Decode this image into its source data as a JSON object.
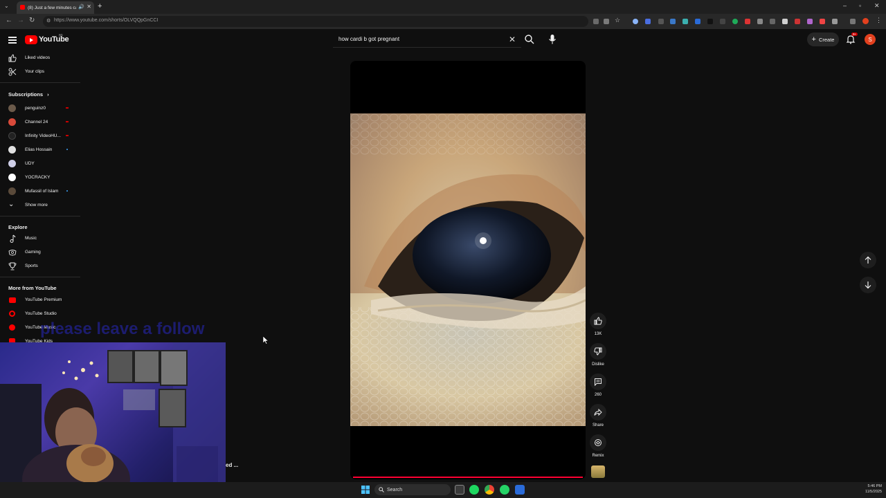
{
  "browser": {
    "tab_title": "(8) Just a few minutes can !",
    "url": "https://www.youtube.com/shorts/OLVQQpGnCCI"
  },
  "header": {
    "logo_text": "YouTube",
    "logo_sup": "80",
    "search_value": "how cardi b got pregnant",
    "create_label": "Create",
    "notif_count": "9+",
    "avatar_letter": "S"
  },
  "sidebar": {
    "top_items": [
      {
        "label": "Liked videos",
        "icon": "thumbs-up-icon"
      },
      {
        "label": "Your clips",
        "icon": "scissors-icon"
      }
    ],
    "subscriptions_heading": "Subscriptions",
    "subscriptions": [
      {
        "label": "penguinz0",
        "status": "live",
        "color": "#6b5a4a"
      },
      {
        "label": "Channel 24",
        "status": "live",
        "color": "#d84a3a"
      },
      {
        "label": "Infinity VideoHU...",
        "status": "live",
        "color": "#222222"
      },
      {
        "label": "Elias Hossain",
        "status": "new",
        "color": "#e0e0e0"
      },
      {
        "label": "UDY",
        "status": "",
        "color": "#cfcfe8"
      },
      {
        "label": "YOCRACKY",
        "status": "",
        "color": "#ffffff"
      },
      {
        "label": "Mufassil of Islam",
        "status": "new",
        "color": "#5a4a3a"
      }
    ],
    "show_more_label": "Show more",
    "explore_heading": "Explore",
    "explore": [
      {
        "label": "Music",
        "icon": "music-note-icon"
      },
      {
        "label": "Gaming",
        "icon": "gamepad-icon"
      },
      {
        "label": "Sports",
        "icon": "trophy-icon"
      }
    ],
    "more_heading": "More from YouTube",
    "more": [
      {
        "label": "YouTube Premium"
      },
      {
        "label": "YouTube Studio"
      },
      {
        "label": "YouTube Music"
      },
      {
        "label": "YouTube Kids"
      }
    ]
  },
  "actions": {
    "like_count": "13K",
    "dislike_label": "Dislike",
    "comment_count": "260",
    "share_label": "Share",
    "remix_label": "Remix"
  },
  "overlay": {
    "follow_text": "please leave a follow",
    "caption_fragment": "ed ..."
  },
  "taskbar": {
    "search_label": "Search",
    "time": "5:46 PM",
    "date": "11/5/2025"
  },
  "colors": {
    "accent_red": "#ff0000",
    "progress_red": "#ff0033",
    "background": "#0f0f0f"
  }
}
